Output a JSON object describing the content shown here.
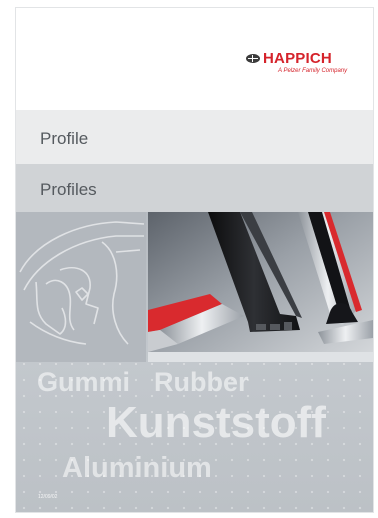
{
  "brand": {
    "name": "HAPPICH",
    "tagline": "A Pelzer Family Company",
    "accent_color": "#d5232b",
    "icon": "happich-logo-icon"
  },
  "titles": {
    "german": "Profile",
    "english": "Profiles"
  },
  "materials": {
    "word1": "Gummi",
    "word2": "Rubber",
    "word3": "Kunststoff",
    "word4": "Aluminium"
  },
  "footer": {
    "code": "12/09/02"
  }
}
